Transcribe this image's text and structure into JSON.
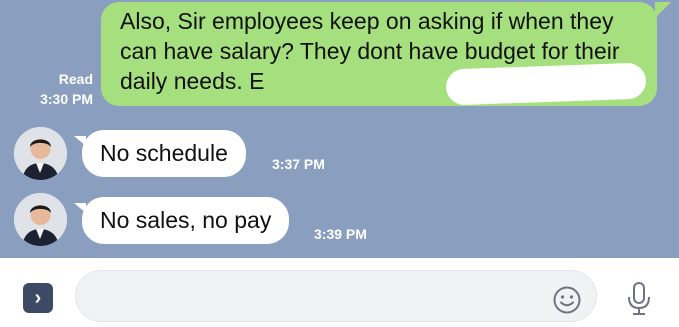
{
  "messages": {
    "outgoing": {
      "text": "Also, Sir employees keep on asking if when they can have salary? They dont have budget for their daily needs. E",
      "read_label": "Read",
      "time": "3:30 PM"
    },
    "incoming": [
      {
        "text": "No schedule",
        "time": "3:37 PM",
        "avatar": "sender-avatar"
      },
      {
        "text": "No sales, no pay",
        "time": "3:39 PM",
        "avatar": "sender-avatar"
      }
    ]
  },
  "input_bar": {
    "expand_icon": "chevron-right-icon",
    "placeholder": "",
    "emoji_icon": "smiley-icon",
    "mic_icon": "microphone-icon"
  },
  "colors": {
    "chat_background": "#8a9fc0",
    "outgoing_bubble": "#a6e07e",
    "incoming_bubble": "#ffffff"
  }
}
